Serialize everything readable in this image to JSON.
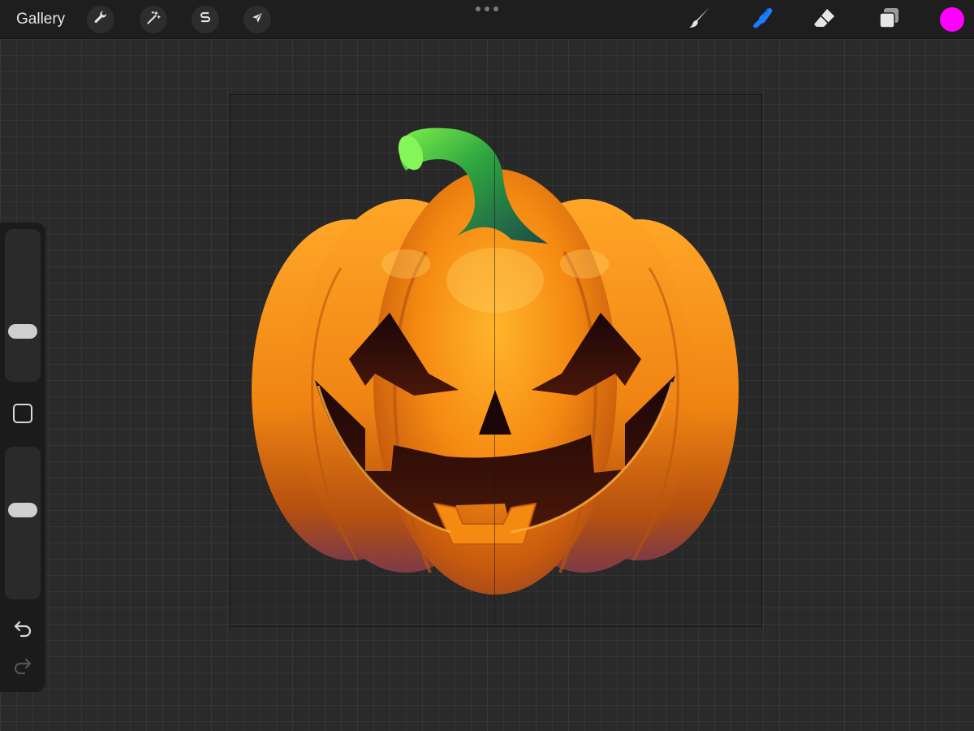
{
  "app": {
    "gallery_label": "Gallery"
  },
  "toolbar_left": [
    {
      "name": "actions-wrench",
      "icon": "wrench-icon"
    },
    {
      "name": "adjustments-magic-wand",
      "icon": "magic-wand-icon"
    },
    {
      "name": "selection",
      "icon": "selection-s-icon"
    },
    {
      "name": "transform",
      "icon": "arrow-cursor-icon"
    }
  ],
  "toolbar_right": [
    {
      "name": "brush",
      "icon": "paintbrush-icon",
      "active": false
    },
    {
      "name": "smudge",
      "icon": "smudge-finger-icon",
      "active": true
    },
    {
      "name": "eraser",
      "icon": "eraser-icon",
      "active": false
    },
    {
      "name": "layers",
      "icon": "layers-icon",
      "active": false
    }
  ],
  "current_color": "#ff00ff",
  "colors": {
    "topbar": "#1e1e1e",
    "background": "#2a2a2a",
    "active_tool": "#1a7cff",
    "pumpkin": "#f08a12",
    "stem": "#2e8a3a"
  },
  "sidebar": {
    "brush_size_level": 0.3,
    "opacity_level": 0.6,
    "modify_icon": "square-modify-icon",
    "undo_icon": "undo-arrow-icon",
    "redo_icon": "redo-arrow-icon",
    "redo_enabled": false
  },
  "canvas": {
    "subject": "jack-o-lantern",
    "symmetry_guide": "vertical"
  }
}
